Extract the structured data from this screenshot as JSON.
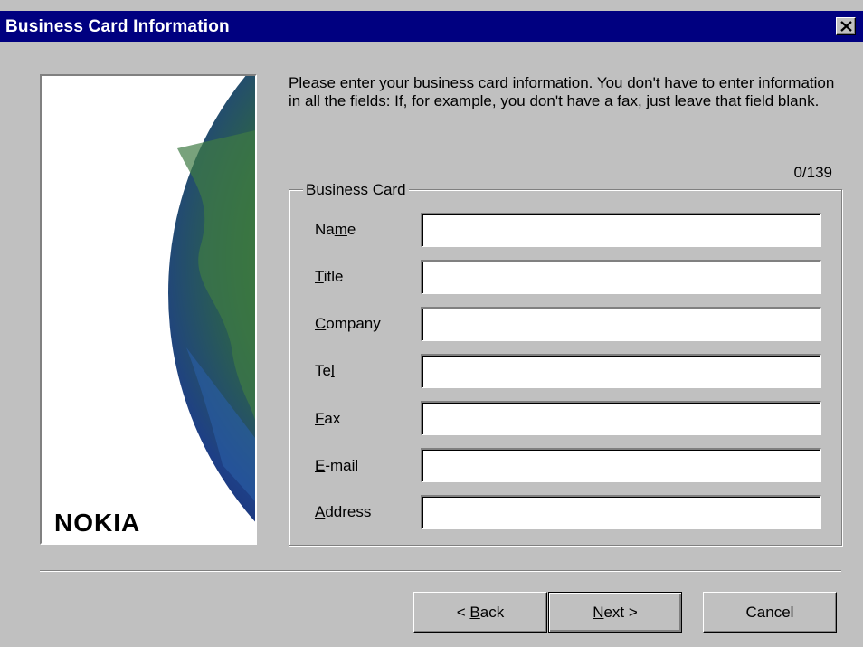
{
  "window": {
    "title": "Business Card Information",
    "close_icon": "close-icon"
  },
  "intro": {
    "text": "Please enter your business card information. You don't have to enter information in all the fields: If, for example, you don't have a fax, just leave that field blank."
  },
  "counter": "0/139",
  "group": {
    "label": "Business Card",
    "fields": [
      {
        "pre": "Na",
        "key": "m",
        "post": "e",
        "value": ""
      },
      {
        "pre": "",
        "key": "T",
        "post": "itle",
        "value": ""
      },
      {
        "pre": "",
        "key": "C",
        "post": "ompany",
        "value": ""
      },
      {
        "pre": "Te",
        "key": "l",
        "post": "",
        "value": ""
      },
      {
        "pre": "",
        "key": "F",
        "post": "ax",
        "value": ""
      },
      {
        "pre": "",
        "key": "E",
        "post": "-mail",
        "value": ""
      },
      {
        "pre": "",
        "key": "A",
        "post": "ddress",
        "value": ""
      }
    ]
  },
  "brand": {
    "logo": "NOKIA"
  },
  "buttons": {
    "back": {
      "pre": "< ",
      "key": "B",
      "post": "ack"
    },
    "next": {
      "pre": "",
      "key": "N",
      "post": "ext >"
    },
    "cancel": "Cancel"
  },
  "colors": {
    "titlebar": "#000080",
    "face": "#c0c0c0"
  }
}
